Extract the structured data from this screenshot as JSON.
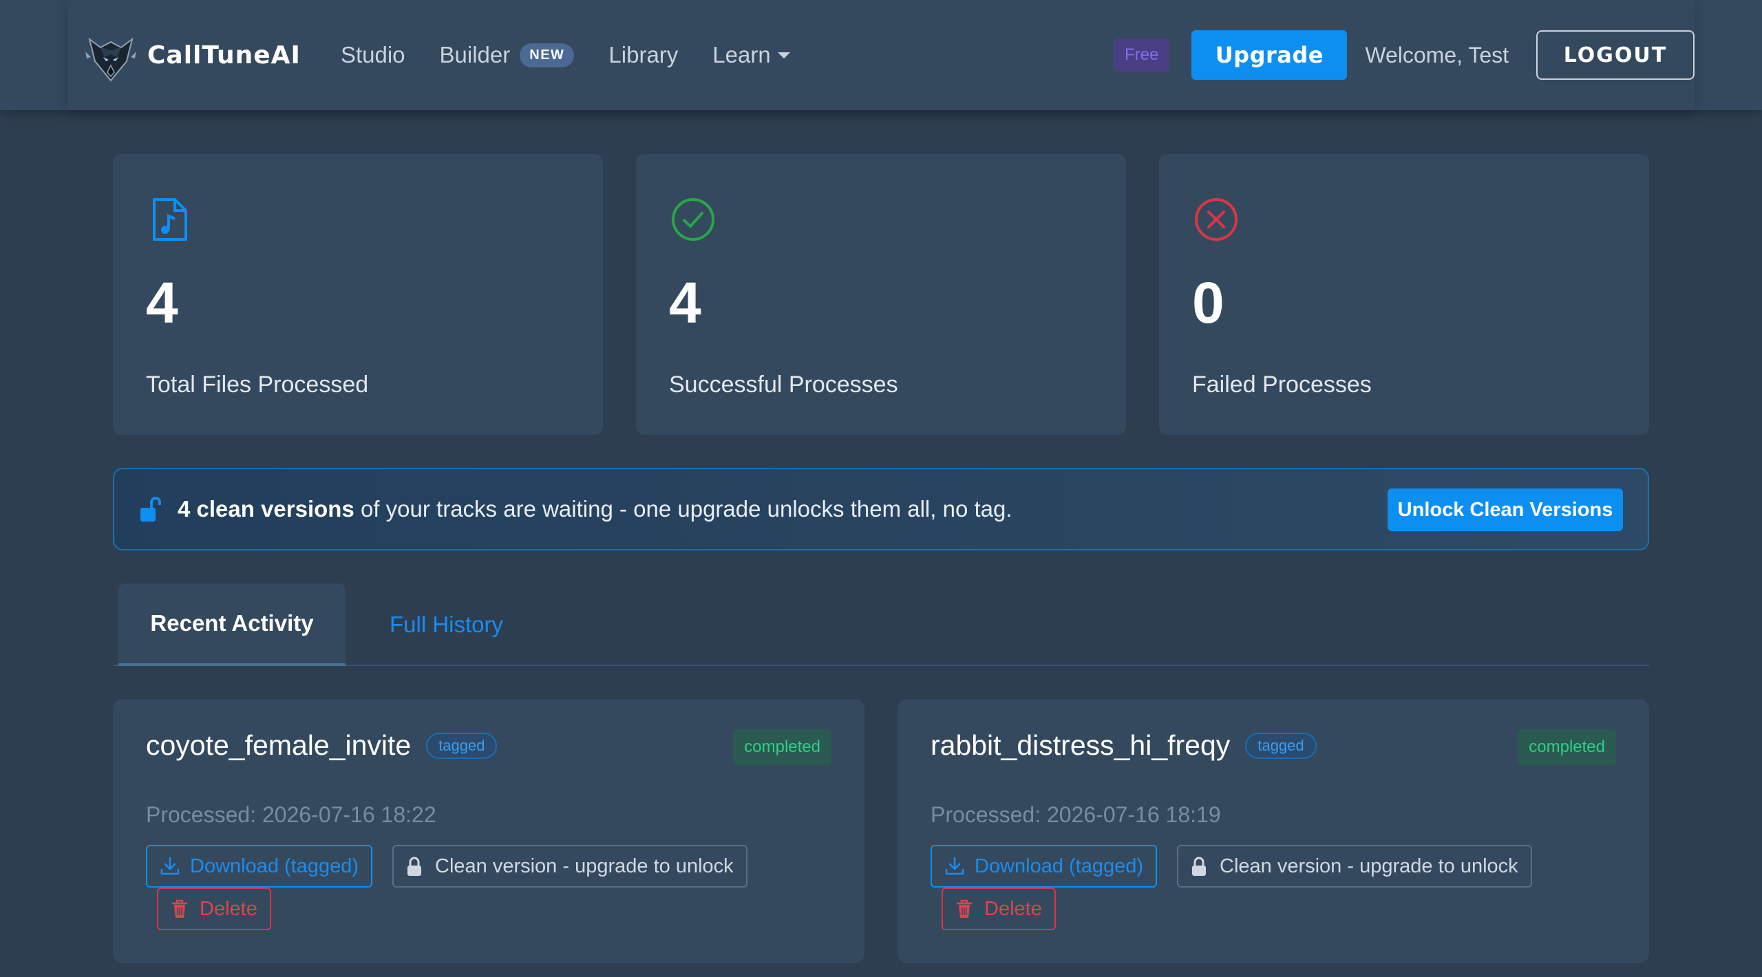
{
  "nav": {
    "brand": "CallTuneAI",
    "links": {
      "studio": "Studio",
      "builder": "Builder",
      "builder_badge": "NEW",
      "library": "Library",
      "learn": "Learn"
    },
    "plan_badge": "Free",
    "upgrade": "Upgrade",
    "welcome": "Welcome, Test",
    "logout": "LOGOUT"
  },
  "stats": [
    {
      "value": "4",
      "label": "Total Files Processed",
      "icon": "music-file-icon",
      "color": "#0d8ff2"
    },
    {
      "value": "4",
      "label": "Successful Processes",
      "icon": "check-circle-icon",
      "color": "#28a745"
    },
    {
      "value": "0",
      "label": "Failed Processes",
      "icon": "x-circle-icon",
      "color": "#dc3545"
    }
  ],
  "alert": {
    "bold": "4 clean versions",
    "text": " of your tracks are waiting - one upgrade unlocks them all, no tag.",
    "button": "Unlock Clean Versions",
    "icon": "unlock-icon"
  },
  "tabs": {
    "active": "Recent Activity",
    "other": "Full History"
  },
  "activity": [
    {
      "name": "coyote_female_invite",
      "tag": "tagged",
      "status": "completed",
      "processed": "Processed: 2026-07-16 18:22",
      "download": "Download (tagged)",
      "clean": "Clean version - upgrade to unlock",
      "delete": "Delete"
    },
    {
      "name": "rabbit_distress_hi_freqy",
      "tag": "tagged",
      "status": "completed",
      "processed": "Processed: 2026-07-16 18:19",
      "download": "Download (tagged)",
      "clean": "Clean version - upgrade to unlock",
      "delete": "Delete"
    }
  ],
  "colors": {
    "background": "#2c3e50",
    "card": "#34495e",
    "accent": "#0d8ff2",
    "success": "#2dce89",
    "danger": "#dc3545",
    "plan": "#7d6ef0"
  }
}
